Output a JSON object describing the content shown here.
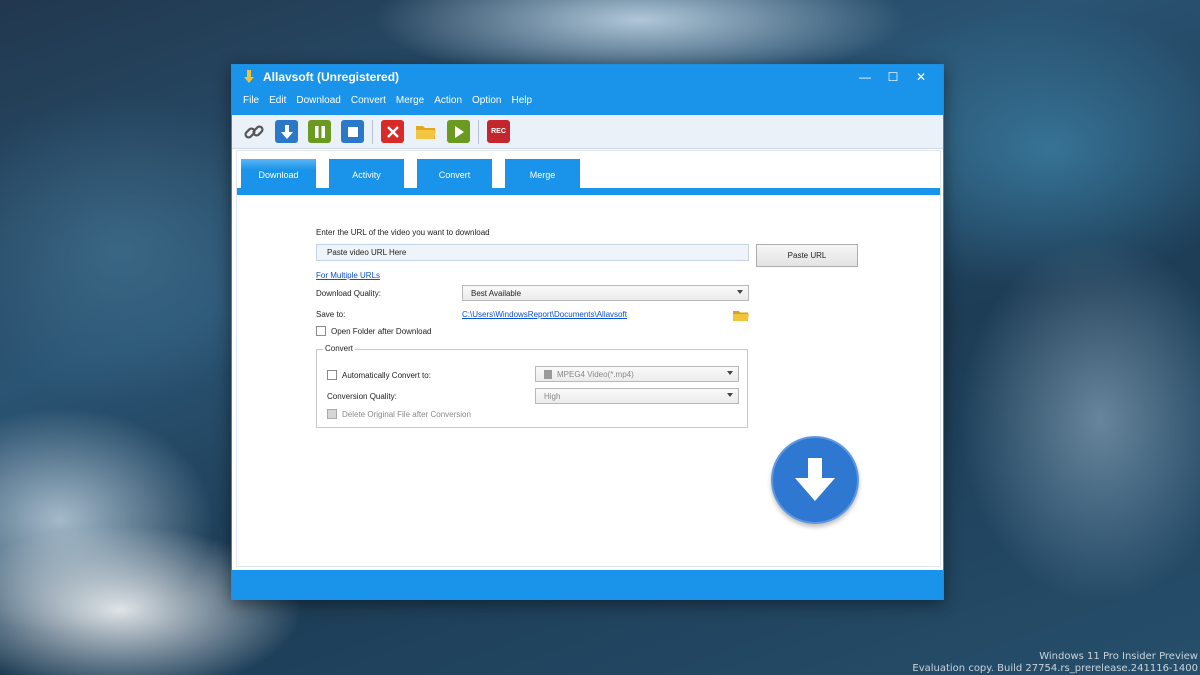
{
  "window": {
    "title": "Allavsoft (Unregistered)",
    "controls": {
      "minimize": "—",
      "maximize": "☐",
      "close": "✕"
    }
  },
  "menu": [
    "File",
    "Edit",
    "Download",
    "Convert",
    "Merge",
    "Action",
    "Option",
    "Help"
  ],
  "toolbar": {
    "buttons": [
      "link-icon",
      "download-icon",
      "pause-icon",
      "stop-icon",
      "delete-icon",
      "folder-icon",
      "play-icon",
      "record-icon"
    ],
    "rec_label": "REC"
  },
  "tabs": [
    "Download",
    "Activity",
    "Convert",
    "Merge"
  ],
  "download": {
    "prompt": "Enter the URL of the video you want to download",
    "url_value": "Paste video URL Here",
    "paste_button": "Paste URL",
    "multiple_urls_link": "For Multiple URLs",
    "quality_label": "Download Quality:",
    "quality_value": "Best Available",
    "save_label": "Save to:",
    "save_path": "C:\\Users\\WindowsReport\\Documents\\Allavsoft",
    "open_folder_label": "Open Folder after Download",
    "open_folder_checked": false
  },
  "convert": {
    "group_title": "Convert",
    "auto_convert_label": "Automatically Convert to:",
    "auto_convert_checked": false,
    "format_value": "MPEG4 Video(*.mp4)",
    "quality_label": "Conversion Quality:",
    "quality_value": "High",
    "delete_original_label": "Delete Original File after Conversion",
    "delete_original_checked": false
  },
  "watermark": {
    "line1": "Windows 11 Pro Insider Preview",
    "line2": "Evaluation copy. Build 27754.rs_prerelease.241116-1400"
  },
  "colors": {
    "accent": "#1a93ea",
    "toolbar_bg": "#eaf1f9",
    "link": "#0a4fd8",
    "big_download": "#2f78d2"
  }
}
